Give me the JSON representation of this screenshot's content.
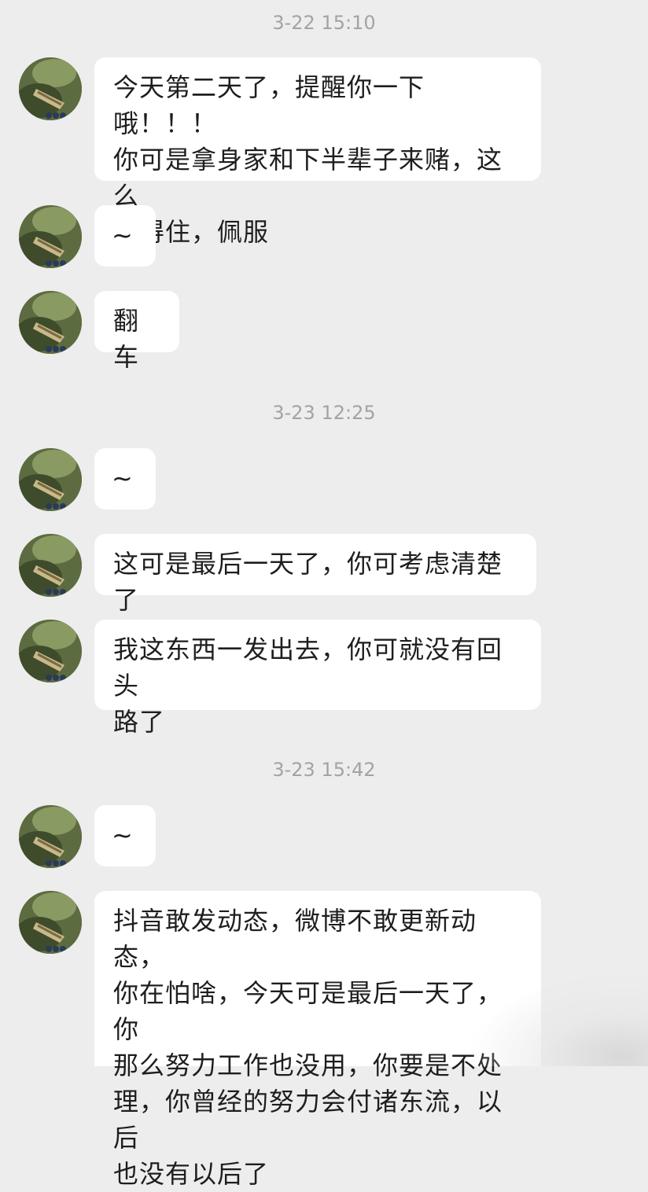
{
  "chat": {
    "timestamps": [
      "3-22 15:10",
      "3-23 12:25",
      "3-23 15:42"
    ],
    "messages": [
      "今天第二天了，提醒你一下哦！！！\n你可是拿身家和下半辈子来赌，这么\n耐得住，佩服",
      "~",
      "翻车",
      "~",
      "这可是最后一天了，你可考虑清楚了",
      "我这东西一发出去，你可就没有回头\n路了",
      "~",
      "抖音敢发动态，微博不敢更新动态，\n你在怕啥，今天可是最后一天了，你\n那么努力工作也没用，你要是不处\n理，你曾经的努力会付诸东流，以后\n也没有以后了"
    ]
  },
  "colors": {
    "background": "#ededed",
    "bubble": "#ffffff",
    "timestamp": "#a3a3a3",
    "text": "#1e1e1e"
  },
  "icons": {
    "avatar": "contact-avatar-icon"
  }
}
